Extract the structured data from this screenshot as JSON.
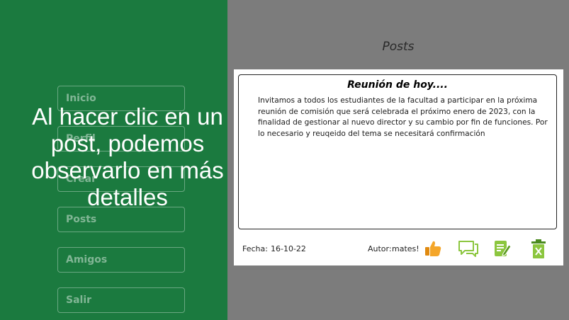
{
  "sidebar": {
    "items": [
      {
        "label": "Inicio"
      },
      {
        "label": "Perfil"
      },
      {
        "label": "Crear"
      },
      {
        "label": "Posts"
      },
      {
        "label": "Amigos"
      },
      {
        "label": "Salir"
      }
    ]
  },
  "overlay": {
    "caption": "Al hacer clic en un post, podemos observarlo en más detalles"
  },
  "main": {
    "title": "Posts",
    "post": {
      "title": "Reunión de hoy....",
      "body": "Invitamos a todos los estudiantes de la facultad a participar en la próxima reunión de comisión que será celebrada el próximo enero de 2023, con la finalidad de gestionar al nuevo director y su cambio por fin de funciones. Por lo necesario y reuqeido del tema se necesitará confirmación",
      "date_label": "Fecha:",
      "date": "16-10-22",
      "author_label": "Autor:",
      "author": "mates!"
    },
    "actions": [
      {
        "icon": "thumbs-up-icon"
      },
      {
        "icon": "comment-icon"
      },
      {
        "icon": "edit-icon"
      },
      {
        "icon": "trash-icon"
      }
    ]
  },
  "colors": {
    "sidebar_bg": "#1b7a3f",
    "backdrop": "#7c7c7c",
    "like": "#f0a020",
    "comment": "#8cc63f",
    "edit": "#8cc63f",
    "delete": "#8cc63f"
  }
}
